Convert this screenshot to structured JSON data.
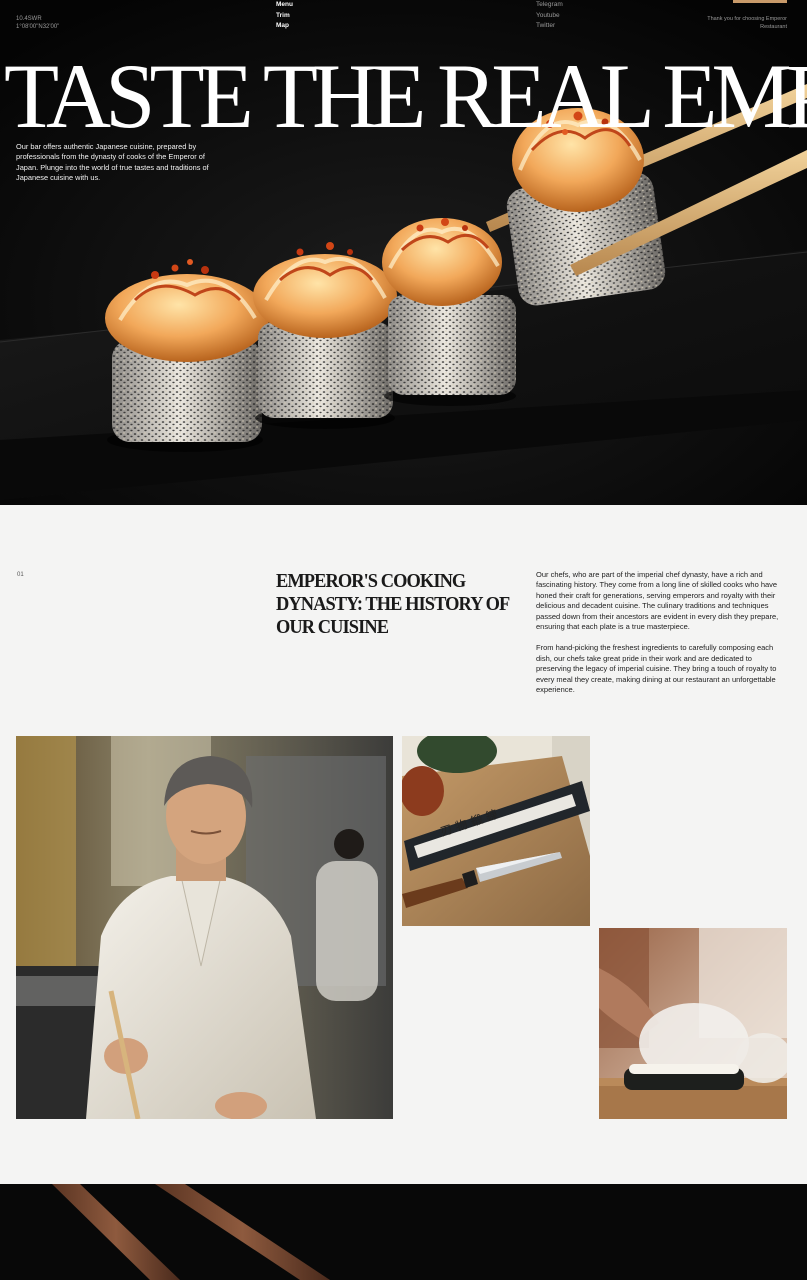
{
  "header": {
    "coords_line1": "10.4SWR",
    "coords_line2": "1°08'00\"N32'00\"",
    "nav": [
      "Menu",
      "Trim",
      "Map"
    ],
    "social": [
      "Telegram",
      "Youtube",
      "Twitter"
    ],
    "thanks": "Thank you for choosing Emperor Restaurant"
  },
  "hero": {
    "headline": "TASTE THE REAL EMPIRE",
    "intro": "Our bar offers authentic Japanese cuisine, prepared by professionals from the dynasty of cooks of the Emperor of Japan. Plunge into the world of true tastes and traditions of Japanese cuisine with us."
  },
  "history": {
    "number": "01",
    "title": "EMPEROR'S COOKING DYNASTY: THE HISTORY OF OUR CUISINE",
    "paragraph1": "Our chefs, who are part of the imperial chef dynasty, have a rich and fascinating history. They come from a long line of skilled cooks who have honed their craft for generations, serving emperors and royalty with their delicious and decadent cuisine. The culinary traditions and techniques passed down from their ancestors are evident in every dish they prepare, ensuring that each plate is a true masterpiece.",
    "paragraph2": "From hand-picking the freshest ingredients to carefully composing each dish, our chefs take great pride in their work and are dedicated to preserving the legacy of imperial cuisine. They bring a touch of royalty to every meal they create, making dining at our restaurant an unforgettable experience."
  },
  "colors": {
    "hero_bg": "#060606",
    "accent": "#c89a6a",
    "page_bg": "#f4f4f3"
  }
}
